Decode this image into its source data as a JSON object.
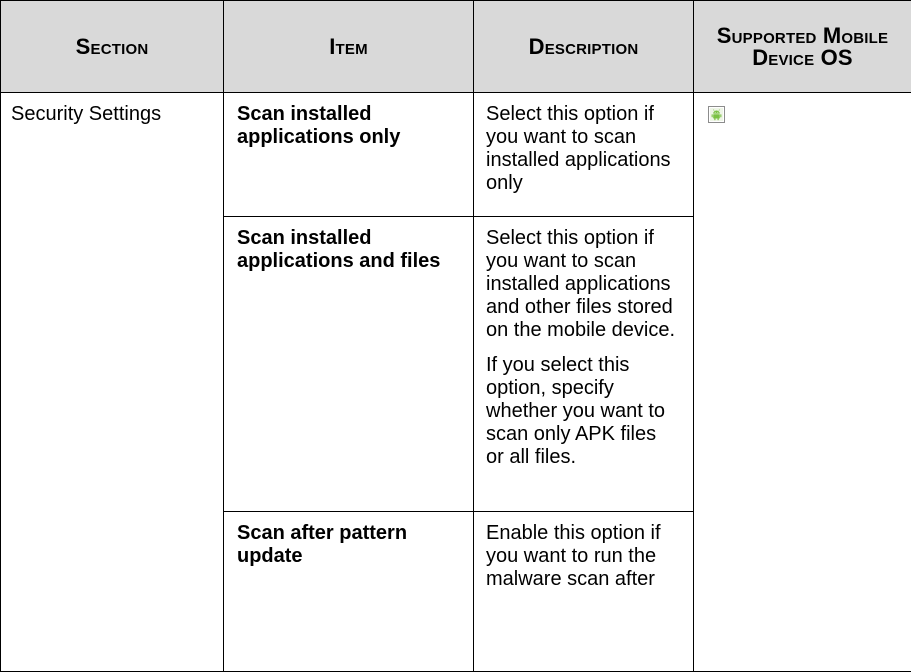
{
  "table": {
    "headers": {
      "section": "Section",
      "item": "Item",
      "description": "Description",
      "os": "Supported Mobile Device OS"
    },
    "section_label": "Security Settings",
    "rows": [
      {
        "item": "Scan installed applications only",
        "description": [
          "Select this option if you want to scan installed applications only"
        ]
      },
      {
        "item": "Scan installed applications and files",
        "description": [
          "Select this option if you want to scan installed applications and other files stored on the mobile device.",
          "If you select this option, specify whether you want to scan only APK files or all files."
        ]
      },
      {
        "item": "Scan after pattern update",
        "description": [
          "Enable this option if you want to run the malware scan after"
        ]
      }
    ],
    "os_icon": "android-icon",
    "colors": {
      "header_bg": "#d9d9d9",
      "border": "#000000",
      "android_green": "#7ac143"
    }
  }
}
